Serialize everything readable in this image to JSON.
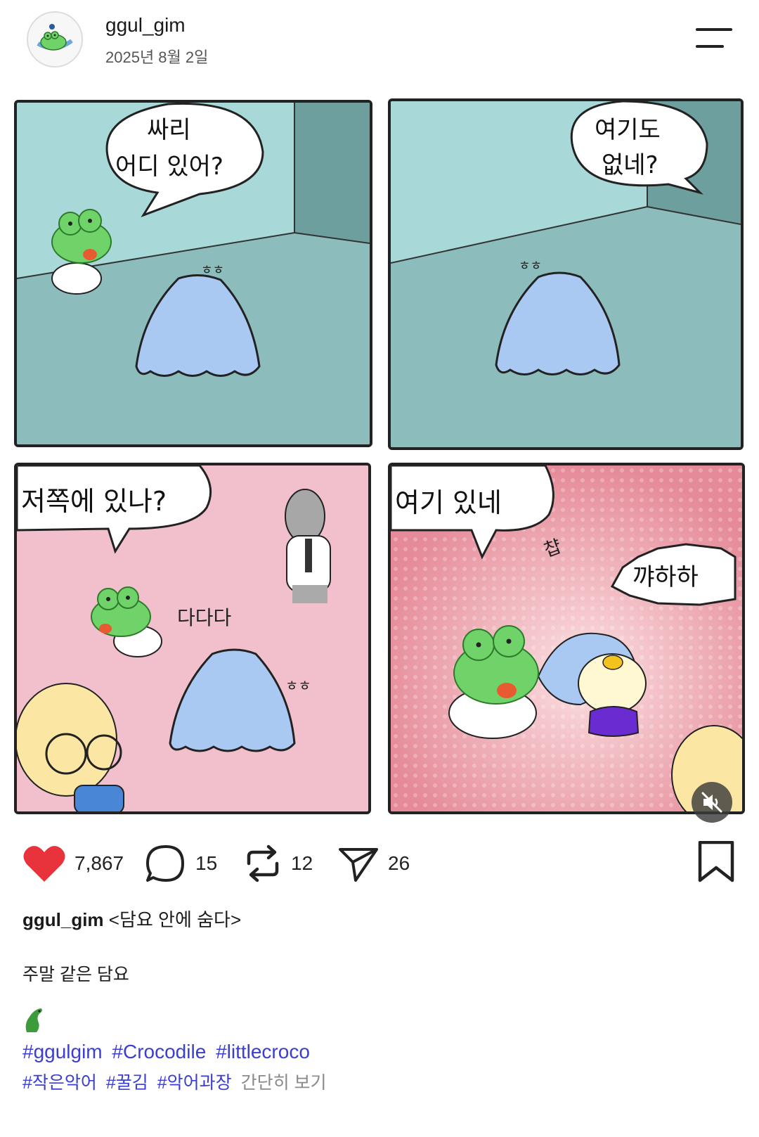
{
  "header": {
    "username": "ggul_gim",
    "date": "2025년 8월 2일",
    "avatar_icon": "crocodile-avatar-icon",
    "menu_icon": "menu-icon"
  },
  "comic": {
    "panel1": {
      "bubble_line1": "싸리",
      "bubble_line2": "어디 있어?",
      "sfx": "ㅎㅎ"
    },
    "panel2": {
      "bubble_line1": "여기도",
      "bubble_line2": "없네?",
      "sfx": "ㅎㅎ"
    },
    "panel3": {
      "bubble": "저쪽에 있나?",
      "sfx_run": "다다다",
      "sfx": "ㅎㅎ"
    },
    "panel4": {
      "bubble": "여기 있네",
      "sfx_pull": "챱",
      "bubble_right": "꺄하하"
    },
    "mute_icon": "speaker-muted-icon"
  },
  "actions": {
    "likes": "7,867",
    "comments": "15",
    "reposts": "12",
    "shares": "26",
    "like_color": "#e8323c"
  },
  "caption": {
    "username": "ggul_gim",
    "title": "<담요 안에 숨다>",
    "text": "주말 같은 담요",
    "hashtags_line1": [
      "#ggulgim",
      "#Crocodile",
      "#littlecroco"
    ],
    "hashtags_line2": [
      "#작은악어",
      "#꿀김",
      "#악어과장"
    ],
    "more": "간단히 보기",
    "link_color": "#3b3ed1"
  }
}
